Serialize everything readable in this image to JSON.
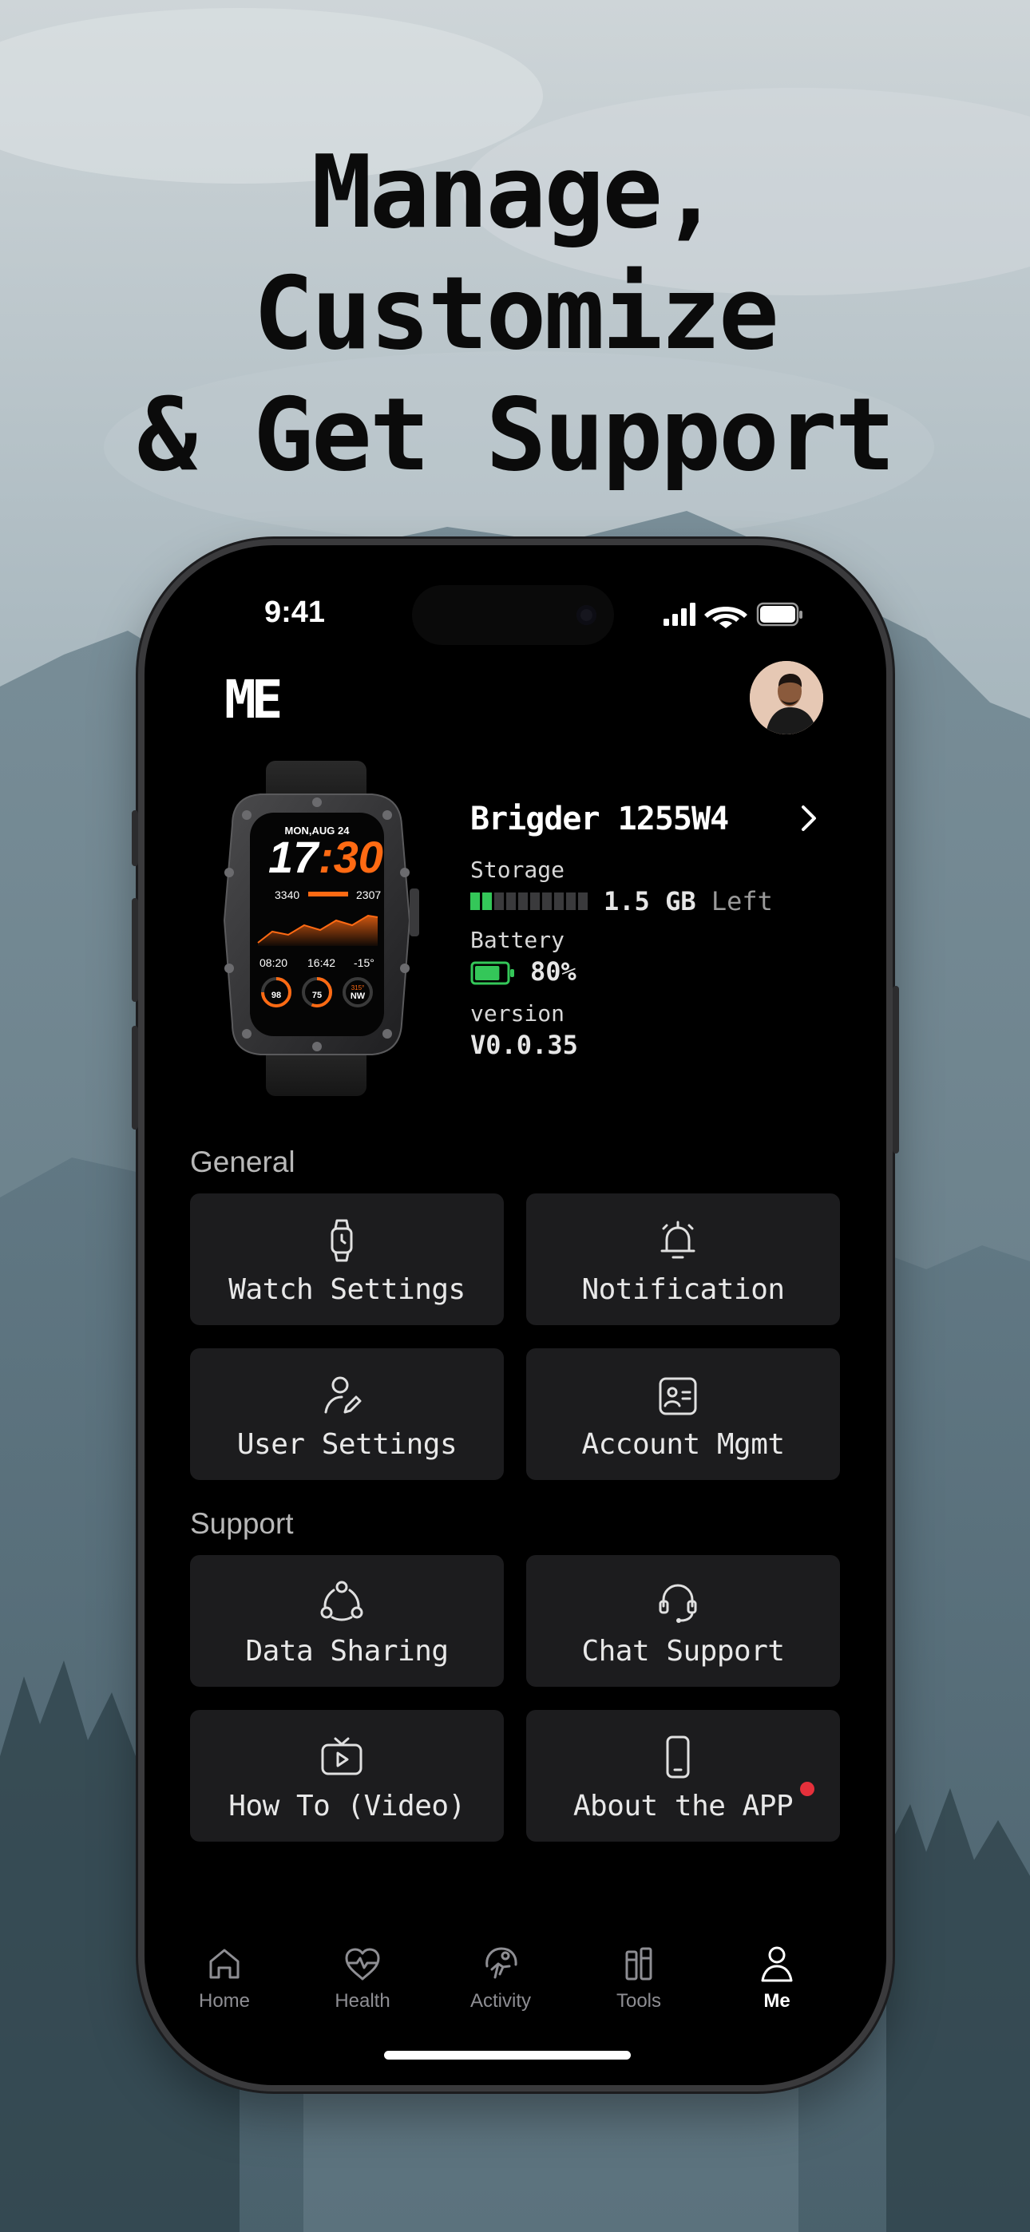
{
  "headline": [
    "Manage,",
    "Customize",
    "& Get Support"
  ],
  "status_bar": {
    "time": "9:41"
  },
  "header": {
    "title": "ME"
  },
  "device": {
    "name": "Brigder 1255W4",
    "storage_label": "Storage",
    "storage_value": "1.5 GB",
    "storage_suffix": "Left",
    "storage_used_fraction": 0.2,
    "battery_label": "Battery",
    "battery_value": "80%",
    "battery_fraction": 0.8,
    "version_label": "version",
    "version_value": "V0.0.35",
    "watch_face": {
      "date": "MON,AUG 24",
      "hour": "17",
      "minute": ":30",
      "stat_left": "3340",
      "stat_right": "2307",
      "sunrise": "08:20",
      "sunset": "16:42",
      "temp": "-15°",
      "ring1": "98",
      "ring2": "75",
      "ring3_top": "315°",
      "ring3": "NW"
    }
  },
  "sections": {
    "general": {
      "label": "General",
      "tiles": [
        {
          "label": "Watch Settings",
          "icon": "watch-icon"
        },
        {
          "label": "Notification",
          "icon": "bell-icon"
        },
        {
          "label": "User Settings",
          "icon": "user-edit-icon"
        },
        {
          "label": "Account Mgmt",
          "icon": "id-card-icon"
        }
      ]
    },
    "support": {
      "label": "Support",
      "tiles": [
        {
          "label": "Data Sharing",
          "icon": "share-nodes-icon"
        },
        {
          "label": "Chat Support",
          "icon": "headset-icon"
        },
        {
          "label": "How To (Video)",
          "icon": "video-icon"
        },
        {
          "label": "About the APP",
          "icon": "phone-icon",
          "badge": true
        }
      ]
    }
  },
  "tabbar": [
    {
      "label": "Home",
      "icon": "home-icon"
    },
    {
      "label": "Health",
      "icon": "heart-pulse-icon"
    },
    {
      "label": "Activity",
      "icon": "activity-icon"
    },
    {
      "label": "Tools",
      "icon": "tools-icon"
    },
    {
      "label": "Me",
      "icon": "person-icon",
      "active": true
    }
  ],
  "colors": {
    "accent_orange": "#ff6a13",
    "battery_green": "#34c759",
    "badge_red": "#e5303b"
  }
}
